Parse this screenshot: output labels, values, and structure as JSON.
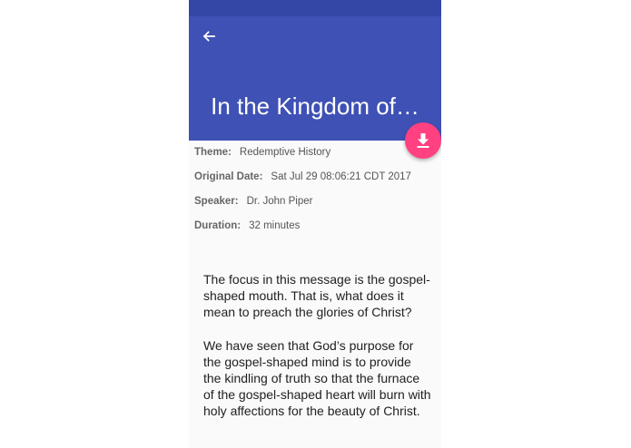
{
  "header": {
    "title": "In the Kingdom of…"
  },
  "icons": {
    "back": "arrow-left-icon",
    "download": "download-icon"
  },
  "colors": {
    "primary": "#3f51b5",
    "status_bar": "#3447a6",
    "accent": "#ff4081"
  },
  "details": {
    "theme_label": "Theme:",
    "theme_value": "Redemptive History",
    "date_label": "Original Date:",
    "date_value": "Sat Jul 29 08:06:21 CDT 2017",
    "speaker_label": "Speaker:",
    "speaker_value": "Dr. John Piper",
    "duration_label": "Duration:",
    "duration_value": "32 minutes"
  },
  "description": {
    "p1": "The focus in this message is the gospel-shaped mouth. That is, what does it mean to preach the glories of Christ?",
    "p2": "We have seen that God’s purpose for the gospel-shaped mind is to provide the kindling of truth so that the furnace of the gospel-shaped heart will burn with holy affections for the beauty of Christ."
  }
}
